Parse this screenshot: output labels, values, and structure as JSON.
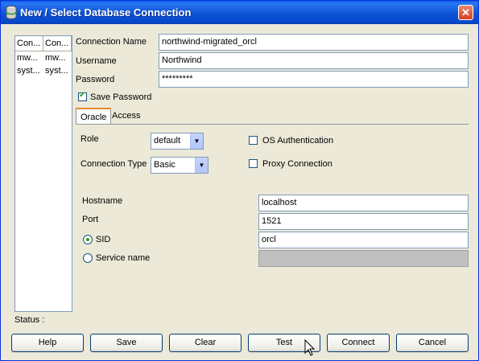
{
  "window": {
    "title": "New / Select Database Connection",
    "close_glyph": "✕"
  },
  "connections_list": {
    "headers": [
      "Con...",
      "Con..."
    ],
    "rows": [
      [
        "mw...",
        "mw..."
      ],
      [
        "syst...",
        "syst..."
      ]
    ]
  },
  "form": {
    "connection_name": {
      "label": "Connection Name",
      "value": "northwind-migrated_orcl"
    },
    "username": {
      "label": "Username",
      "value": "Northwind"
    },
    "password": {
      "label": "Password",
      "value": "*********"
    },
    "save_password": {
      "label": "Save Password",
      "checked": true
    }
  },
  "tabs": [
    {
      "label": "Oracle",
      "active": true
    },
    {
      "label": "Access",
      "active": false
    }
  ],
  "oracle": {
    "role": {
      "label": "Role",
      "value": "default"
    },
    "connection_type": {
      "label": "Connection Type",
      "value": "Basic"
    },
    "os_auth": {
      "label": "OS Authentication",
      "checked": false
    },
    "proxy": {
      "label": "Proxy Connection",
      "checked": false
    },
    "hostname": {
      "label": "Hostname",
      "value": "localhost"
    },
    "port": {
      "label": "Port",
      "value": "1521"
    },
    "sid": {
      "label": "SID",
      "value": "orcl",
      "selected": true
    },
    "service_name": {
      "label": "Service name",
      "value": "",
      "selected": false
    }
  },
  "status": {
    "label": "Status :"
  },
  "buttons": {
    "help": "Help",
    "save": "Save",
    "clear": "Clear",
    "test": "Test",
    "connect": "Connect",
    "cancel": "Cancel"
  }
}
